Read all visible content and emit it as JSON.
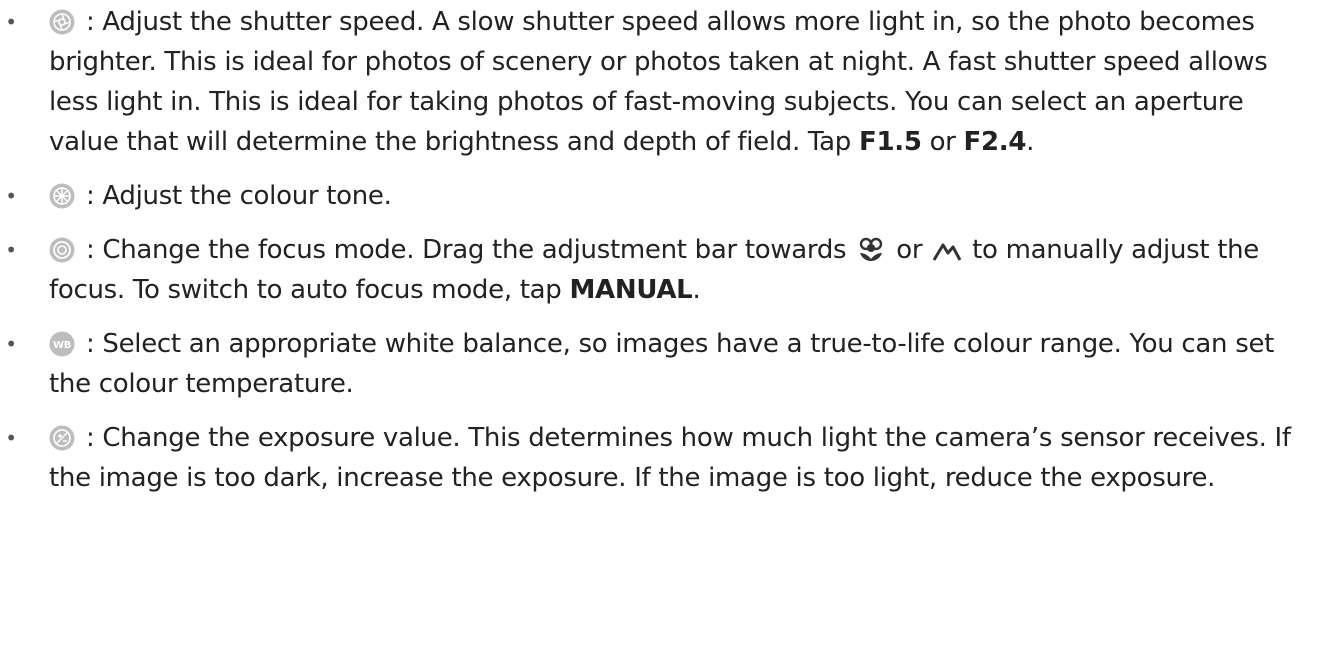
{
  "colors": {
    "text": "#222222",
    "icon_fill": "#bdbdbd",
    "icon_stroke": "#ffffff",
    "inline_icon": "#333333"
  },
  "items": [
    {
      "icon": "shutter-speed-icon",
      "sep": " : ",
      "text1": "Adjust the shutter speed. A slow shutter speed allows more light in, so the photo becomes brighter. This is ideal for photos of scenery or photos taken at night. A fast shutter speed allows less light in. This is ideal for taking photos of fast-moving subjects. You can select an aperture value that will determine the brightness and depth of field. Tap ",
      "bold1": "F1.5",
      "mid": " or ",
      "bold2": "F2.4",
      "end": "."
    },
    {
      "icon": "colour-tone-icon",
      "sep": " : ",
      "text": "Adjust the colour tone."
    },
    {
      "icon": "focus-mode-icon",
      "sep": " : ",
      "text1": "Change the focus mode. Drag the adjustment bar towards ",
      "macro_icon": "macro-flower-icon",
      "mid": " or ",
      "landscape_icon": "mountain-icon",
      "text2": " to manually adjust the focus. To switch to auto focus mode, tap ",
      "bold": "MANUAL",
      "end": "."
    },
    {
      "icon": "white-balance-icon",
      "icon_label": "WB",
      "sep": " : ",
      "text": "Select an appropriate white balance, so images have a true-to-life colour range. You can set the colour temperature."
    },
    {
      "icon": "exposure-icon",
      "sep": " : ",
      "text": "Change the exposure value. This determines how much light the camera’s sensor receives. If the image is too dark, increase the exposure. If the image is too light, reduce the exposure."
    }
  ],
  "bullet": "•"
}
